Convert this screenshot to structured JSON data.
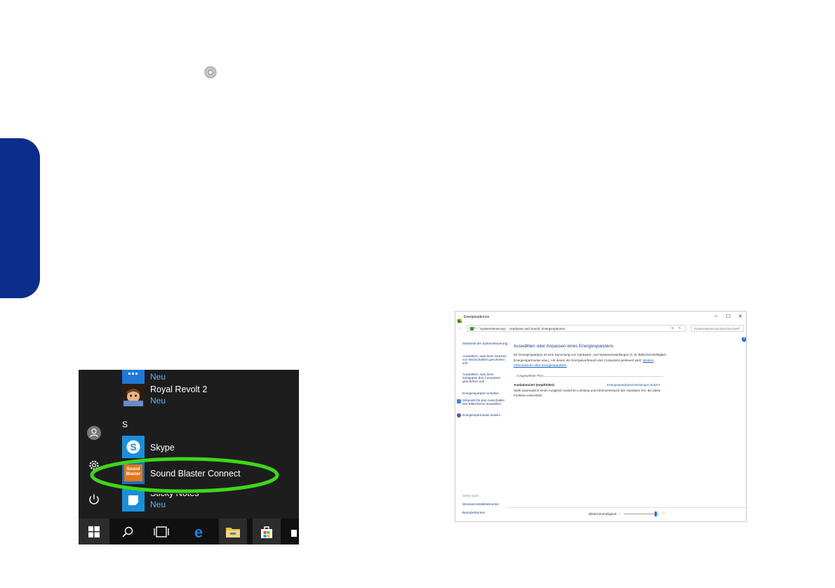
{
  "start_menu": {
    "items": [
      {
        "title": "",
        "sub": "Neu"
      },
      {
        "title": "Royal Revolt 2",
        "sub": "Neu"
      },
      {
        "title": "Skype",
        "sub": ""
      },
      {
        "title": "Sound Blaster Connect",
        "sub": ""
      },
      {
        "title": "Sticky Notes",
        "sub": "Neu"
      }
    ],
    "section_letter": "S",
    "sound_blaster_tile_text": "Sound Blaster"
  },
  "power_window": {
    "title": "Energieoptionen",
    "controls": {
      "minimize": "–",
      "maximize": "☐",
      "close": "✕"
    },
    "breadcrumb": [
      "Systemsteuerung",
      "Hardware and Sound",
      "Energieoptionen"
    ],
    "breadcrumb_sep": "›",
    "search_placeholder": "Systemsteuerung durchsuchen",
    "help": "?",
    "sidebar": {
      "home": "Startseite der Systemsteuerung",
      "links": [
        [
          "Auswählen, was beim Drücken",
          "von Netzschaltern geschehen",
          "soll"
        ],
        [
          "Auswählen, was beim",
          "Zuklappen des Computers",
          "geschehen soll"
        ],
        [
          "Energiesparplan erstellen"
        ],
        [
          "Zeitpunkt für das Ausschalten",
          "des Bildschirms auswählen"
        ],
        [
          "Energiesparmodus ändern"
        ]
      ],
      "see_also": "Siehe auch",
      "see_also_links": [
        "Windows-Mobilitätscenter",
        "Benutzerkonten"
      ]
    },
    "main": {
      "heading": "Auswählen oder Anpassen eines Energiesparplans",
      "desc_line1": "Ein Energiesparplan ist eine Sammlung von Hardware- und Systemeinstellungen (z. B. Bildschirmhelligkeit,",
      "desc_line2_a": "Energiesparmodus usw.), mit denen der Energieverbrauch des Computers gesteuert wird.",
      "desc_line2_link": "Weitere",
      "desc_line3_link": "Informationen über Energiesparpläne",
      "selected_plan_label": "Ausgewählter Plan",
      "plan_name": "Ausbalanciert (empfohlen)",
      "plan_settings_link": "Energiesparplaneinstellungen ändern",
      "plan_desc_line1": "Stellt automatisch einen Ausgleich zwischen Leistung und Stromverbrauch der Hardware her, die diese",
      "plan_desc_line2": "Funktion unterstützt."
    },
    "brightness_label": "Bildschirmhelligkeit:",
    "brightness_level": 0.9
  }
}
